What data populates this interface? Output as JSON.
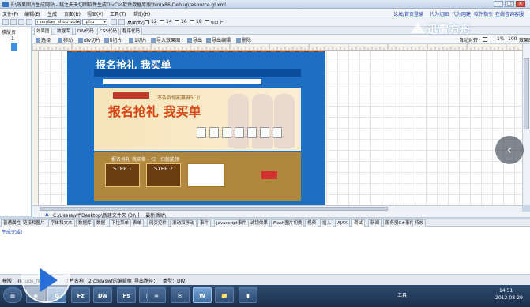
{
  "window": {
    "title": "F:\\效果图片生成网站 - 桃之夭夭切图软件生成DivCss软件数据库版\\bin\\x86\\Debug\\resource.gl.xml",
    "buttons": [
      "_",
      "□",
      "✕"
    ]
  },
  "menubar": {
    "items": [
      "文件(F)",
      "编辑(E)",
      "生成",
      "页面(B)",
      "视图(V)",
      "工具(T)",
      "帮助(H)"
    ],
    "links": [
      "论坛/首页登录",
      "代为切图",
      "代为网建",
      "软件指引",
      "在线咨询客服"
    ]
  },
  "toolbar": {
    "page_combo": "member_shop_votes",
    "ext_combo": ".php",
    "scale_label": "桌面大小",
    "zoom_checks": [
      "12",
      "14",
      "16",
      "18",
      "9"
    ],
    "ie_label": "9以上"
  },
  "left_panel": {
    "header": "模版页",
    "row_number": "1"
  },
  "editor_tabs": [
    "效果图",
    "数据库",
    "DIV代码",
    "CSS代码",
    "程序代码"
  ],
  "cut_tools": {
    "items": [
      "选择",
      "移动",
      "div切片",
      "li切片",
      "1切片",
      "导入效果图",
      "导出",
      "导出编辑",
      "删除"
    ],
    "auto_align": "自动对齐",
    "zoom": "1%",
    "zoom_label": "100",
    "effect_label": "效果图"
  },
  "design": {
    "brand": "报名抢礼 我买单",
    "headline": "报名抢礼 我买单",
    "slogan": "不告诉你能赢得5门!",
    "steps_title": "报名抢礼 我买单 - 扫一扫就能领",
    "step1": "STEP 1",
    "step2": "STEP 2"
  },
  "pathbar": {
    "path": "C:\\Users\\wf\\Desktop\\新建文件夹 (3)\\十一最新活动\\"
  },
  "bottom_tabs": [
    "普通属性",
    "链接和图片",
    "字体和文本",
    "数据库",
    "数据",
    "下拉菜单",
    "表单",
    "网页控件",
    "滚动和移动",
    "事件",
    "javascript事件",
    "滤镜效果",
    "Flash图片切换",
    "视频",
    "插入",
    "AJAX",
    "调试",
    "新闻",
    "服务器C#事件",
    "特效"
  ],
  "active_bottom_tab": 16,
  "output": {
    "line": "生成完成!"
  },
  "status": {
    "template": "模版：include_file",
    "cut_count": "切片名称：2",
    "editor": "cddaswf的编辑框",
    "export_path": "导出路径：",
    "type": "类型：DIV"
  },
  "taskbar": {
    "apps": [
      "⊞",
      "◉",
      "G",
      "Fz",
      "Dw",
      "Ps",
      "▣",
      "∞",
      "✉",
      "W",
      "📁",
      "▮"
    ],
    "tool_label": "工具",
    "time": "14:51",
    "date": "2012-08-29"
  },
  "watermark": "迅雷方舟",
  "colors": {
    "accent": "#1e6fc4",
    "taskbar": "#1b2f4a"
  }
}
